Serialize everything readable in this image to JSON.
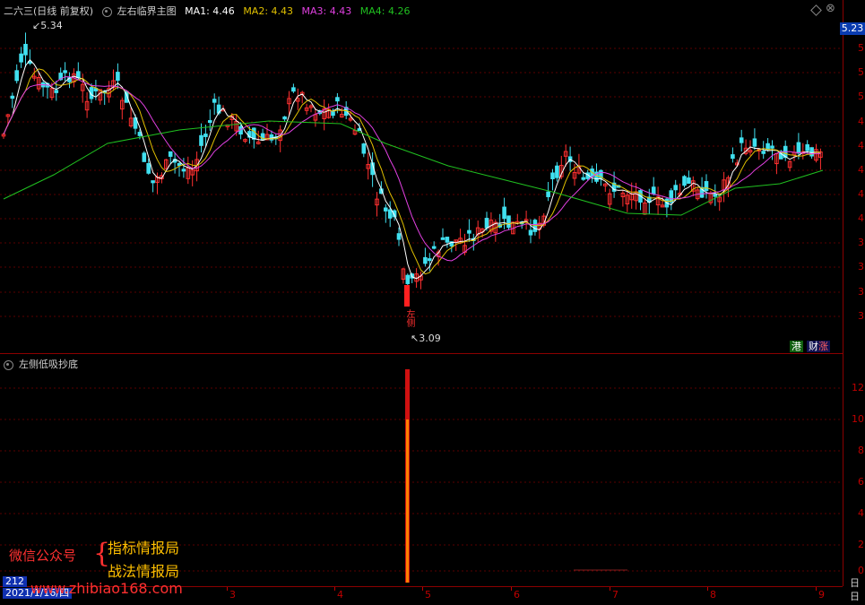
{
  "header": {
    "title": "二六三(日线 前复权)",
    "main_indicator": "左右临界主图",
    "ma": [
      {
        "label": "MA1: 4.46",
        "color": "#ffffff"
      },
      {
        "label": "MA2: 4.43",
        "color": "#e0c000"
      },
      {
        "label": "MA3: 4.43",
        "color": "#e040e0"
      },
      {
        "label": "MA4: 4.26",
        "color": "#20c020"
      }
    ]
  },
  "price_tag": "5.23",
  "high_label": "5.34",
  "low_label": "3.09",
  "signal_text": "左侧",
  "badges": {
    "hk": "港",
    "finance": "财",
    "rise": "涨"
  },
  "main_yticks": [
    "5",
    "5",
    "5",
    "4",
    "4",
    "4",
    "4",
    "4",
    "3",
    "3",
    "3",
    "3"
  ],
  "sub": {
    "title": "左侧低吸抄底",
    "yticks": [
      "12",
      "10",
      "8",
      "6",
      "4",
      "2",
      "0"
    ]
  },
  "xlabels": [
    "3",
    "4",
    "5",
    "6",
    "7",
    "8",
    "9"
  ],
  "watermark": {
    "wechat_label": "微信公众号",
    "brace": "{",
    "line1": "指标情报局",
    "line2": "战法情报局",
    "url": "www.zhibiao168.com",
    "code_box": "212",
    "date_box": "2021/1/16/四"
  },
  "right_bottom": [
    "日",
    "日"
  ],
  "colors": {
    "up": "#ff3030",
    "down": "#40e0f0",
    "ma1": "#ffffff",
    "ma2": "#e0c000",
    "ma3": "#e040e0",
    "ma4": "#20c020",
    "grid": "#8b0000"
  }
}
